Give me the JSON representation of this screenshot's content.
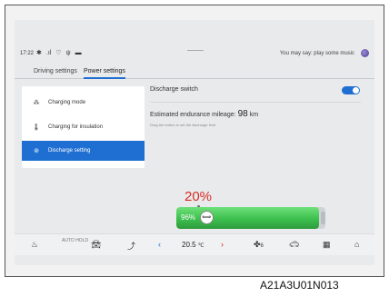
{
  "status": {
    "time": "17:22",
    "voice_hint": "You may say:  play some music"
  },
  "tabs": [
    {
      "label": "Driving settings"
    },
    {
      "label": "Power settings"
    }
  ],
  "sidebar": {
    "items": [
      {
        "label": "Charging mode",
        "icon": "charging-icon"
      },
      {
        "label": "Charging for insulation",
        "icon": "thermometer-icon"
      },
      {
        "label": "Discharge setting",
        "icon": "discharge-icon"
      }
    ]
  },
  "content": {
    "discharge_switch_label": "Discharge switch",
    "discharge_switch_on": true,
    "mileage_label": "Estimated endurance mileage:",
    "mileage_value": "98",
    "mileage_unit": "km",
    "hint": "Drag the button to set the discharge limit",
    "limit_percent": "20%",
    "battery_level_label": "96%",
    "battery_level": 0.96,
    "limit_fraction": 0.2
  },
  "bottombar": {
    "auto_hold": "AUTO\nHOLD",
    "temperature": "20.5",
    "temperature_unit": "℃",
    "fan_level": "6"
  },
  "footer_code": "A21A3U01N013",
  "colors": {
    "accent": "#1f6fd3",
    "warning": "#d92b22",
    "battery_green": "#3cbf4d"
  }
}
